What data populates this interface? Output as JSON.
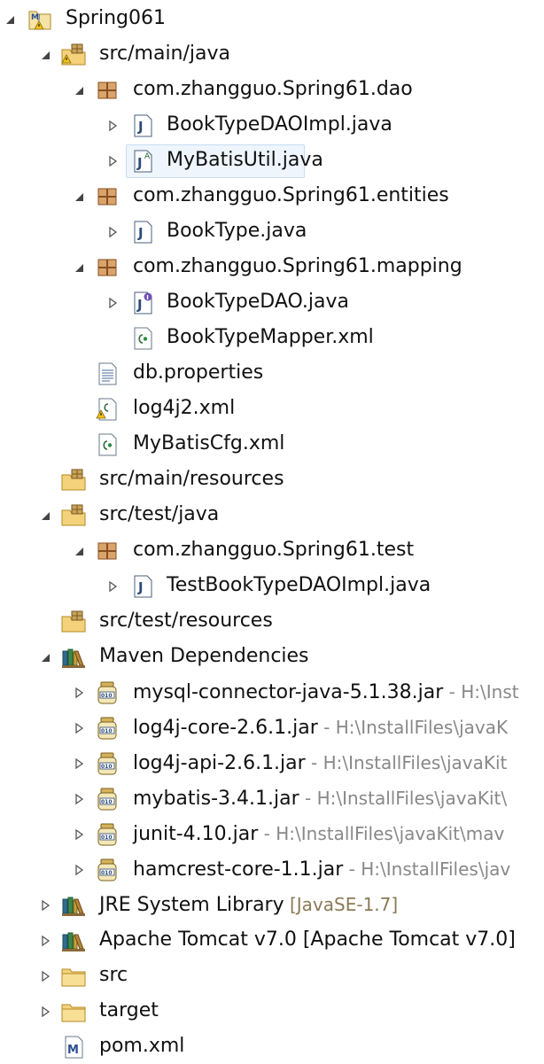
{
  "tree": [
    {
      "label": "Spring061",
      "icon": "maven-project-warning-icon",
      "twisty": "expanded"
    },
    {
      "label": "src/main/java",
      "icon": "source-folder-warning-icon",
      "twisty": "expanded"
    },
    {
      "label": "com.zhangguo.Spring61.dao",
      "icon": "package-icon",
      "twisty": "expanded"
    },
    {
      "label": "BookTypeDAOImpl.java",
      "icon": "java-class-file-icon",
      "twisty": "collapsed"
    },
    {
      "label": "MyBatisUtil.java",
      "icon": "java-abstract-file-icon",
      "twisty": "collapsed",
      "selected": true
    },
    {
      "label": "com.zhangguo.Spring61.entities",
      "icon": "package-icon",
      "twisty": "expanded"
    },
    {
      "label": "BookType.java",
      "icon": "java-class-file-icon",
      "twisty": "collapsed"
    },
    {
      "label": "com.zhangguo.Spring61.mapping",
      "icon": "package-icon",
      "twisty": "expanded"
    },
    {
      "label": "BookTypeDAO.java",
      "icon": "java-interface-file-icon",
      "twisty": "collapsed"
    },
    {
      "label": "BookTypeMapper.xml",
      "icon": "xml-file-icon",
      "twisty": "none"
    },
    {
      "label": "db.properties",
      "icon": "properties-file-icon",
      "twisty": "none"
    },
    {
      "label": "log4j2.xml",
      "icon": "xml-file-warning-icon",
      "twisty": "none"
    },
    {
      "label": "MyBatisCfg.xml",
      "icon": "xml-file-icon",
      "twisty": "none"
    },
    {
      "label": "src/main/resources",
      "icon": "source-folder-icon",
      "twisty": "none"
    },
    {
      "label": "src/test/java",
      "icon": "source-folder-icon",
      "twisty": "expanded"
    },
    {
      "label": "com.zhangguo.Spring61.test",
      "icon": "package-icon",
      "twisty": "expanded"
    },
    {
      "label": "TestBookTypeDAOImpl.java",
      "icon": "java-class-file-icon",
      "twisty": "collapsed"
    },
    {
      "label": "src/test/resources",
      "icon": "source-folder-icon",
      "twisty": "none"
    },
    {
      "label": "Maven Dependencies",
      "icon": "library-icon",
      "twisty": "expanded"
    },
    {
      "label": "mysql-connector-java-5.1.38.jar",
      "icon": "jar-icon",
      "twisty": "collapsed",
      "location": " - H:\\Inst"
    },
    {
      "label": "log4j-core-2.6.1.jar",
      "icon": "jar-icon",
      "twisty": "collapsed",
      "location": " - H:\\InstallFiles\\javaK"
    },
    {
      "label": "log4j-api-2.6.1.jar",
      "icon": "jar-icon",
      "twisty": "collapsed",
      "location": " - H:\\InstallFiles\\javaKit"
    },
    {
      "label": "mybatis-3.4.1.jar",
      "icon": "jar-icon",
      "twisty": "collapsed",
      "location": " - H:\\InstallFiles\\javaKit\\"
    },
    {
      "label": "junit-4.10.jar",
      "icon": "jar-icon",
      "twisty": "collapsed",
      "location": " - H:\\InstallFiles\\javaKit\\mav"
    },
    {
      "label": "hamcrest-core-1.1.jar",
      "icon": "jar-icon",
      "twisty": "collapsed",
      "location": " - H:\\InstallFiles\\jav"
    },
    {
      "label": "JRE System Library",
      "icon": "library-icon",
      "twisty": "collapsed",
      "decoration": " [JavaSE-1.7]"
    },
    {
      "label": "Apache Tomcat v7.0 [Apache Tomcat v7.0]",
      "icon": "library-icon",
      "twisty": "collapsed"
    },
    {
      "label": "src",
      "icon": "folder-icon",
      "twisty": "collapsed"
    },
    {
      "label": "target",
      "icon": "folder-icon",
      "twisty": "collapsed"
    },
    {
      "label": "pom.xml",
      "icon": "maven-pom-file-icon",
      "twisty": "none"
    }
  ]
}
